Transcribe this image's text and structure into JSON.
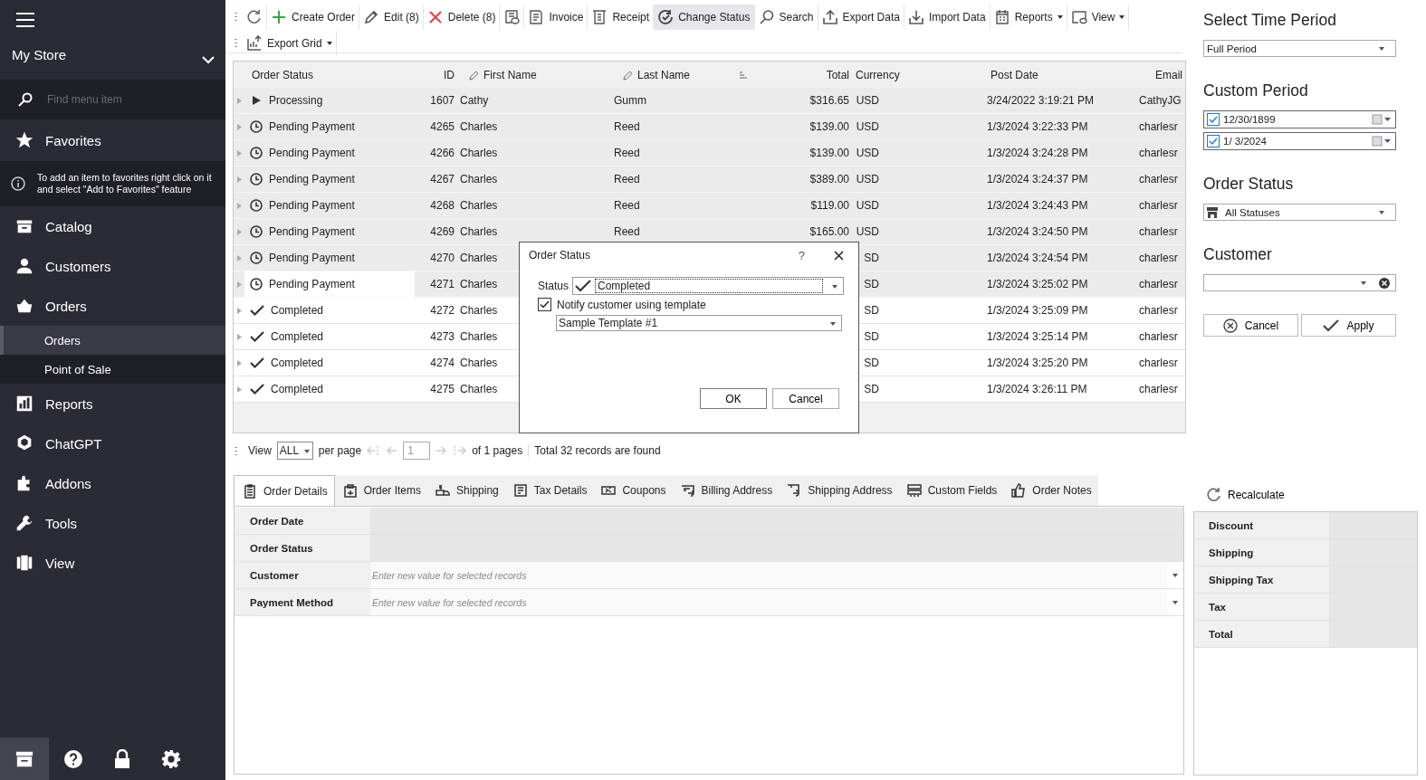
{
  "sidebar": {
    "store": {
      "name": "My Store"
    },
    "search": {
      "placeholder": "Find menu item"
    },
    "favorites": {
      "label": "Favorites",
      "hint": "To add an item to favorites right click on it and select \"Add to Favorites\" feature"
    },
    "items": [
      {
        "label": "Catalog"
      },
      {
        "label": "Customers"
      },
      {
        "label": "Orders",
        "children": [
          {
            "label": "Orders",
            "selected": true
          },
          {
            "label": "Point of Sale",
            "selected": false
          }
        ]
      },
      {
        "label": "Reports"
      },
      {
        "label": "ChatGPT"
      },
      {
        "label": "Addons"
      },
      {
        "label": "Tools"
      },
      {
        "label": "View"
      }
    ],
    "bottom_bar": [
      {
        "selected": true
      },
      {
        "selected": false
      },
      {
        "selected": false
      },
      {
        "selected": false
      }
    ]
  },
  "toolbar": {
    "rows": [
      [
        {
          "kind": "refresh",
          "selected": false
        },
        {
          "kind": "create",
          "label": "Create Order",
          "selected": false
        },
        {
          "kind": "edit",
          "label": "Edit (8)",
          "selected": false
        },
        {
          "kind": "delete",
          "label": "Delete (8)",
          "selected": false
        },
        {
          "kind": "preview",
          "selected": false
        },
        {
          "kind": "invoice",
          "label": "Invoice",
          "selected": false
        },
        {
          "kind": "receipt",
          "label": "Receipt",
          "selected": false
        },
        {
          "kind": "status",
          "label": "Change Status",
          "selected": true
        },
        {
          "kind": "search",
          "label": "Search",
          "selected": false
        },
        {
          "kind": "export",
          "label": "Export Data",
          "selected": false
        },
        {
          "kind": "import",
          "label": "Import Data",
          "selected": false
        },
        {
          "kind": "reports",
          "label": "Reports",
          "selected": false,
          "dropdown": true
        },
        {
          "kind": "view",
          "label": "View",
          "selected": false,
          "dropdown": true
        }
      ],
      [
        {
          "kind": "grid",
          "label": "Export Grid",
          "selected": false,
          "dropdown": true
        }
      ]
    ]
  },
  "table": {
    "columns": [
      {
        "label": "Order Status",
        "editable": false
      },
      {
        "label": "ID",
        "editable": false
      },
      {
        "label": "First Name",
        "editable": true
      },
      {
        "label": "Last Name",
        "editable": true
      },
      {
        "editable": false
      },
      {
        "label": "Total",
        "editable": false
      },
      {
        "label": "Currency",
        "editable": false
      },
      {
        "label": "Post Date",
        "editable": false
      },
      {
        "label": "Email",
        "editable": false
      }
    ],
    "rows": [
      {
        "status": "Processing",
        "kind": "processing",
        "id": "1607",
        "first_name": "Cathy",
        "last_name": "Gumm",
        "total": "$316.65",
        "currency": "USD",
        "post_date": "3/24/2022 3:19:21 PM",
        "email": "CathyJG",
        "selected": true,
        "focused": false
      },
      {
        "status": "Pending Payment",
        "kind": "pending",
        "id": "4265",
        "first_name": "Charles",
        "last_name": "Reed",
        "total": "$139.00",
        "currency": "USD",
        "post_date": "1/3/2024 3:22:33 PM",
        "email": "charlesr",
        "selected": true,
        "focused": false
      },
      {
        "status": "Pending Payment",
        "kind": "pending",
        "id": "4266",
        "first_name": "Charles",
        "last_name": "Reed",
        "total": "$139.00",
        "currency": "USD",
        "post_date": "1/3/2024 3:24:28 PM",
        "email": "charlesr",
        "selected": true,
        "focused": false
      },
      {
        "status": "Pending Payment",
        "kind": "pending",
        "id": "4267",
        "first_name": "Charles",
        "last_name": "Reed",
        "total": "$389.00",
        "currency": "USD",
        "post_date": "1/3/2024 3:24:37 PM",
        "email": "charlesr",
        "selected": true,
        "focused": false
      },
      {
        "status": "Pending Payment",
        "kind": "pending",
        "id": "4268",
        "first_name": "Charles",
        "last_name": "Reed",
        "total": "$119.00",
        "currency": "USD",
        "post_date": "1/3/2024 3:24:43 PM",
        "email": "charlesr",
        "selected": true,
        "focused": false
      },
      {
        "status": "Pending Payment",
        "kind": "pending",
        "id": "4269",
        "first_name": "Charles",
        "last_name": "Reed",
        "total": "$165.00",
        "currency": "USD",
        "post_date": "1/3/2024 3:24:50 PM",
        "email": "charlesr",
        "selected": true,
        "focused": false
      },
      {
        "status": "Pending Payment",
        "kind": "pending",
        "id": "4270",
        "first_name": "Charles",
        "currency": "SD",
        "post_date": "1/3/2024 3:24:54 PM",
        "email": "charlesr",
        "selected": true,
        "focused": false
      },
      {
        "status": "Pending Payment",
        "kind": "pending",
        "id": "4271",
        "first_name": "Charles",
        "currency": "SD",
        "post_date": "1/3/2024 3:25:02 PM",
        "email": "charlesr",
        "selected": true,
        "focused": true
      },
      {
        "status": "Completed",
        "kind": "completed",
        "id": "4272",
        "first_name": "Charles",
        "currency": "SD",
        "post_date": "1/3/2024 3:25:09 PM",
        "email": "charlesr",
        "selected": false,
        "focused": false
      },
      {
        "status": "Completed",
        "kind": "completed",
        "id": "4273",
        "first_name": "Charles",
        "currency": "SD",
        "post_date": "1/3/2024 3:25:14 PM",
        "email": "charlesr",
        "selected": false,
        "focused": false
      },
      {
        "status": "Completed",
        "kind": "completed",
        "id": "4274",
        "first_name": "Charles",
        "currency": "SD",
        "post_date": "1/3/2024 3:25:20 PM",
        "email": "charlesr",
        "selected": false,
        "focused": false
      },
      {
        "status": "Completed",
        "kind": "completed",
        "id": "4275",
        "first_name": "Charles",
        "currency": "SD",
        "post_date": "1/3/2024 3:26:11 PM",
        "email": "charlesr",
        "selected": false,
        "focused": false
      }
    ]
  },
  "dialog": {
    "title": "Order Status",
    "help": "?",
    "status_label": "Status",
    "status_value": "Completed",
    "notify": {
      "label": "Notify customer using template",
      "checked": true
    },
    "template": "Sample Template #1",
    "buttons": [
      "OK",
      "Cancel"
    ]
  },
  "pager": {
    "view_label": "View",
    "per_page": "ALL",
    "per_page_label": "per page",
    "page": "1",
    "pages": "of 1 pages",
    "summary": "Total 32 records are found"
  },
  "tabs": [
    {
      "label": "Order Details",
      "selected": true
    },
    {
      "label": "Order Items",
      "selected": false
    },
    {
      "label": "Shipping",
      "selected": false
    },
    {
      "label": "Tax Details",
      "selected": false
    },
    {
      "label": "Coupons",
      "selected": false
    },
    {
      "label": "Billing Address",
      "selected": false
    },
    {
      "label": "Shipping Address",
      "selected": false
    },
    {
      "label": "Custom Fields",
      "selected": false
    },
    {
      "label": "Order Notes",
      "selected": false
    }
  ],
  "details": [
    {
      "label": "Order Date",
      "kind": "readonly"
    },
    {
      "label": "Order Status",
      "kind": "readonly"
    },
    {
      "label": "Customer",
      "kind": "dropdown",
      "placeholder": "Enter new value for selected records"
    },
    {
      "label": "Payment Method",
      "kind": "dropdown",
      "placeholder": "Enter new value for selected records"
    }
  ],
  "filters": {
    "time_period": {
      "title": "Select Time Period",
      "value": "Full Period"
    },
    "custom_period": {
      "title": "Custom Period",
      "dates": [
        {
          "value": "12/30/1899",
          "checked": true
        },
        {
          "value": "1/ 3/2024",
          "checked": true
        }
      ]
    },
    "order_status": {
      "title": "Order Status",
      "value": "All Statuses"
    },
    "customer": {
      "title": "Customer"
    },
    "buttons": [
      "Cancel",
      "Apply"
    ]
  },
  "totals": {
    "recalculate": "Recalculate",
    "rows": [
      "Discount",
      "Shipping",
      "Shipping Tax",
      "Tax",
      "Total"
    ]
  }
}
